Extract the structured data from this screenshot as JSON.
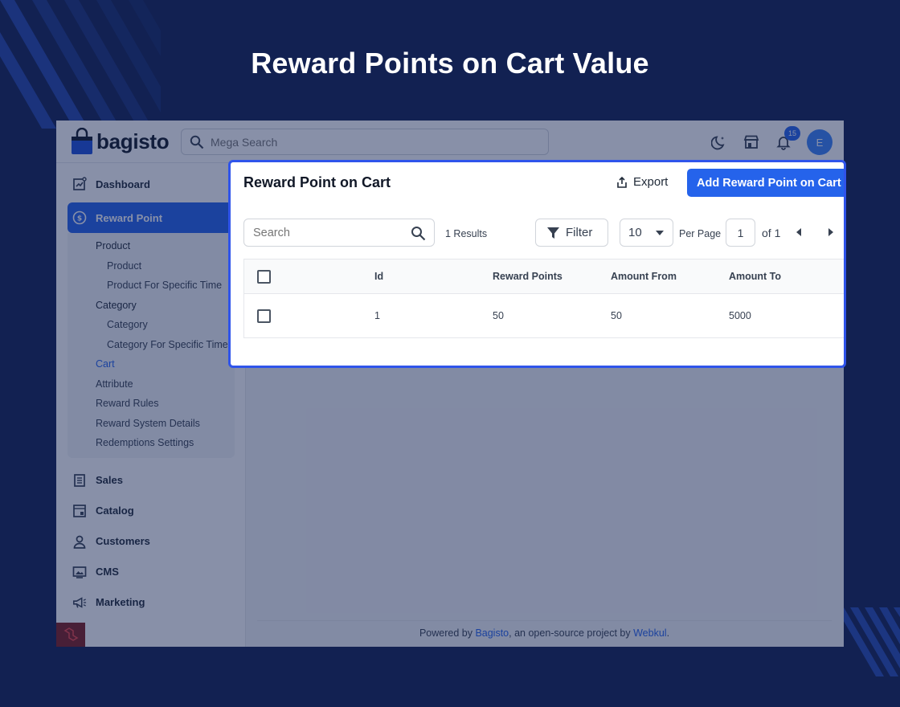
{
  "hero": {
    "title": "Reward Points on Cart Value"
  },
  "topbar": {
    "logo_text": "bagisto",
    "search_placeholder": "Mega Search",
    "notification_count": "15",
    "avatar_initial": "E"
  },
  "sidebar": {
    "items_top": [
      {
        "label": "Dashboard",
        "icon": "dashboard-icon"
      },
      {
        "label": "Reward Point",
        "icon": "reward-point-icon"
      }
    ],
    "sub_items": [
      {
        "label": "Product",
        "level": 1
      },
      {
        "label": "Product",
        "level": 2
      },
      {
        "label": "Product For Specific Time",
        "level": 2
      },
      {
        "label": "Category",
        "level": 1
      },
      {
        "label": "Category",
        "level": 2
      },
      {
        "label": "Category For Specific Time",
        "level": 2
      },
      {
        "label": "Cart",
        "level": 1
      },
      {
        "label": "Attribute",
        "level": 1
      },
      {
        "label": "Reward Rules",
        "level": 1
      },
      {
        "label": "Reward System Details",
        "level": 1
      },
      {
        "label": "Redemptions Settings",
        "level": 1
      }
    ],
    "items_bottom": [
      {
        "label": "Sales",
        "icon": "sales-icon"
      },
      {
        "label": "Catalog",
        "icon": "catalog-icon"
      },
      {
        "label": "Customers",
        "icon": "customers-icon"
      },
      {
        "label": "CMS",
        "icon": "cms-icon"
      },
      {
        "label": "Marketing",
        "icon": "marketing-icon"
      }
    ]
  },
  "card": {
    "title": "Reward Point on Cart",
    "export_label": "Export",
    "add_label": "Add Reward Point on Cart",
    "search_placeholder": "Search",
    "results": "1 Results",
    "filter_label": "Filter",
    "per_page_value": "10",
    "per_page_label": "Per Page",
    "page_value": "1",
    "of_label": "of 1",
    "columns": [
      "Id",
      "Reward Points",
      "Amount From",
      "Amount To"
    ],
    "rows": [
      [
        "1",
        "50",
        "50",
        "5000"
      ]
    ]
  },
  "footer": {
    "prefix": "Powered by ",
    "link1": "Bagisto",
    "middle": ", an open-source project by ",
    "link2": "Webkul",
    "suffix": "."
  },
  "colors": {
    "background": "#122152",
    "accent": "#2563eb",
    "highlight_border": "#2f54eb"
  }
}
